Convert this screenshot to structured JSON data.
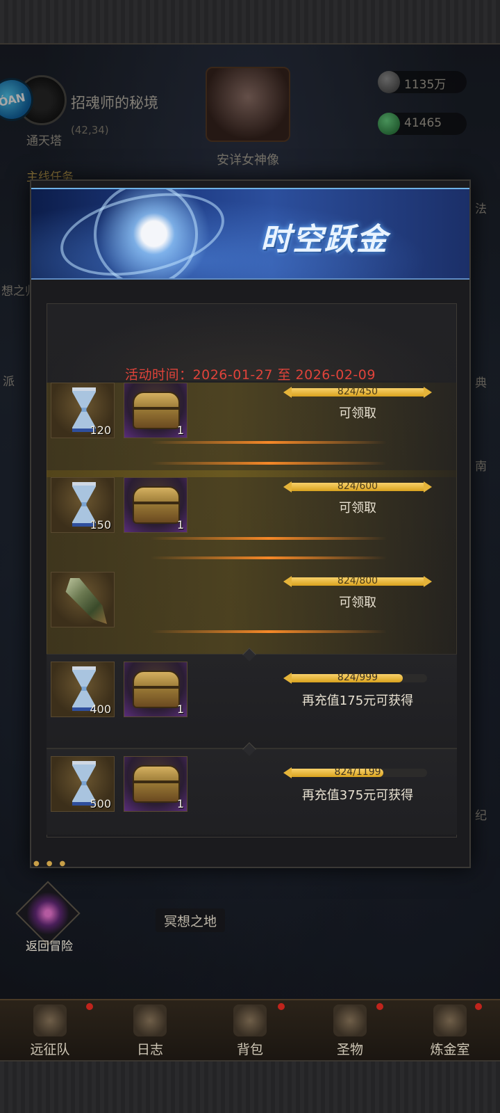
{
  "hud": {
    "badge_text": "ÓAN",
    "location_name": "招魂师的秘境",
    "location_coord": "(42,34)",
    "boss_name": "安详女神像",
    "currency_1": "1135万",
    "currency_2": "41465",
    "side_left_1": "通天塔",
    "side_left_2": "主线任务",
    "side_left_3": "想之归",
    "side_left_4": "派",
    "side_right_1": "法",
    "side_right_2": "典",
    "side_right_3": "南",
    "side_right_4": "纪"
  },
  "modal": {
    "title": "时空跃金",
    "event_time": "活动时间：2026-01-27 至 2026-02-09",
    "rows": [
      {
        "items": [
          {
            "icon": "hourglass-icon",
            "qty": "120"
          },
          {
            "icon": "chest-icon",
            "qty": "1"
          }
        ],
        "progress_text": "824/450",
        "progress": 1.0,
        "status": "可领取"
      },
      {
        "items": [
          {
            "icon": "hourglass-icon",
            "qty": "150"
          },
          {
            "icon": "chest-icon",
            "qty": "1"
          }
        ],
        "progress_text": "824/600",
        "progress": 1.0,
        "status": "可领取"
      },
      {
        "items": [
          {
            "icon": "blade-icon",
            "qty": ""
          }
        ],
        "progress_text": "824/800",
        "progress": 1.0,
        "status": "可领取"
      },
      {
        "items": [
          {
            "icon": "hourglass-icon",
            "qty": "400"
          },
          {
            "icon": "chest-icon",
            "qty": "1"
          }
        ],
        "progress_text": "824/999",
        "progress": 0.825,
        "status": "再充值175元可获得"
      },
      {
        "items": [
          {
            "icon": "hourglass-icon",
            "qty": "500"
          },
          {
            "icon": "chest-icon",
            "qty": "1"
          }
        ],
        "progress_text": "824/1199",
        "progress": 0.687,
        "status": "再充值375元可获得"
      }
    ]
  },
  "footer": {
    "return_label": "返回冒险",
    "area_label": "冥想之地",
    "nav": [
      {
        "label": "远征队",
        "icon": "helmet-icon"
      },
      {
        "label": "日志",
        "icon": "scroll-icon"
      },
      {
        "label": "背包",
        "icon": "backpack-icon"
      },
      {
        "label": "圣物",
        "icon": "torch-icon"
      },
      {
        "label": "炼金室",
        "icon": "alchemy-icon"
      }
    ]
  },
  "colors": {
    "accent_gold": "#e5b43a",
    "event_time_red": "#e0433a",
    "notification_red": "#c0241c"
  }
}
